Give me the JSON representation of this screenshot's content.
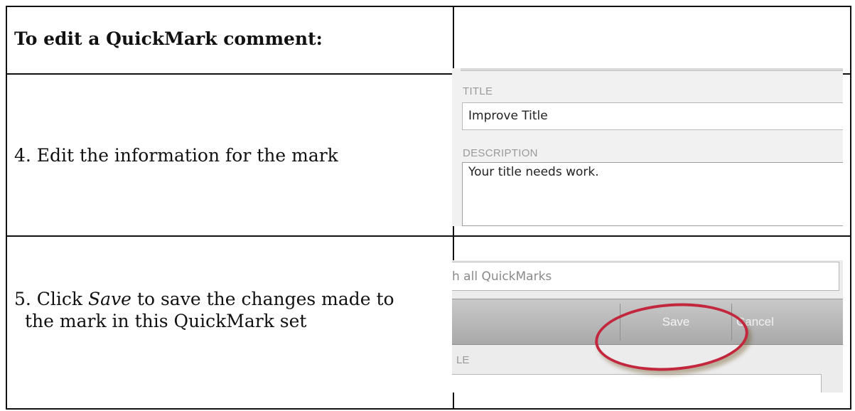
{
  "header": {
    "title": "To edit a QuickMark comment:"
  },
  "steps": [
    {
      "text": "4. Edit the information for the mark"
    },
    {
      "prefix": "5. Click ",
      "emphasis": "Save",
      "suffix": " to save the changes made to",
      "line2": "the mark in this QuickMark set"
    }
  ],
  "edit_form": {
    "title_label": "TITLE",
    "title_value": "Improve Title",
    "description_label": "DESCRIPTION",
    "description_value": "Your title needs work."
  },
  "save_panel": {
    "search_value": "h all QuickMarks",
    "save_label": "Save",
    "cancel_label": "Cancel",
    "field_label_fragment": "LE"
  },
  "colors": {
    "highlight_ring": "#c2273d"
  }
}
